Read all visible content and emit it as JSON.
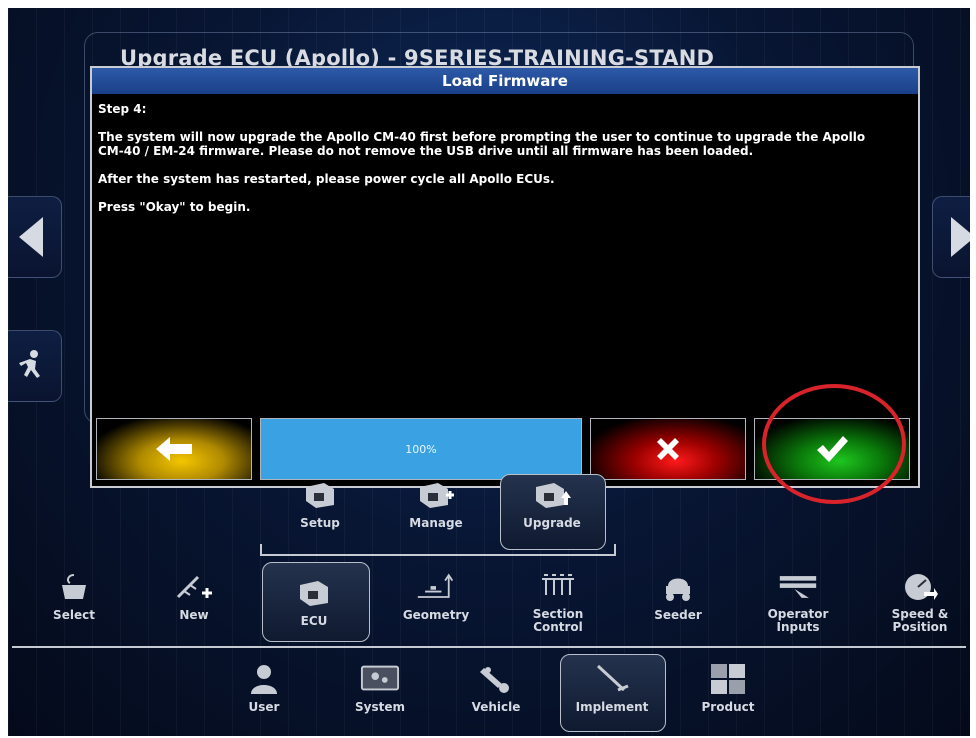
{
  "window": {
    "title": "Upgrade ECU (Apollo) - 9SERIES-TRAINING-STAND"
  },
  "dialog": {
    "title": "Load Firmware",
    "step": "Step 4:",
    "paragraph1_line1": "The system will now upgrade the Apollo CM-40 first before prompting the user to continue to upgrade the Apollo",
    "paragraph1_line2": "CM-40 / EM-24 firmware. Please do not remove the USB drive until all firmware has been loaded.",
    "paragraph2": "After the system has restarted, please power cycle all Apollo ECUs.",
    "paragraph3": "Press \"Okay\" to begin.",
    "progress_text": "100%",
    "progress_value": 1.0
  },
  "ecu_menu": {
    "items": [
      {
        "label": "Setup",
        "icon": "setup-icon"
      },
      {
        "label": "Manage",
        "icon": "manage-icon"
      },
      {
        "label": "Upgrade",
        "icon": "upgrade-icon",
        "selected": true
      }
    ]
  },
  "implement_menu": {
    "items": [
      {
        "label": "Select",
        "icon": "select-icon"
      },
      {
        "label": "New",
        "icon": "new-icon"
      },
      {
        "label": "ECU",
        "icon": "ecu-icon",
        "selected": true
      },
      {
        "label": "Geometry",
        "icon": "geometry-icon"
      },
      {
        "label": "Section\nControl",
        "icon": "section-control-icon"
      },
      {
        "label": "Seeder",
        "icon": "seeder-icon"
      },
      {
        "label": "Operator\nInputs",
        "icon": "operator-inputs-icon"
      },
      {
        "label": "Speed &\nPosition",
        "icon": "speed-position-icon"
      }
    ]
  },
  "main_menu": {
    "items": [
      {
        "label": "User",
        "icon": "user-icon"
      },
      {
        "label": "System",
        "icon": "system-icon"
      },
      {
        "label": "Vehicle",
        "icon": "vehicle-icon"
      },
      {
        "label": "Implement",
        "icon": "implement-icon",
        "selected": true
      },
      {
        "label": "Product",
        "icon": "product-icon"
      }
    ]
  },
  "colors": {
    "accent_blue": "#1a3f88",
    "progress": "#3aa2e3",
    "back_button": "#f4c600",
    "cancel_button": "#ff1a1a",
    "ok_button": "#1fc61f",
    "annotation_circle": "#d8232a"
  }
}
